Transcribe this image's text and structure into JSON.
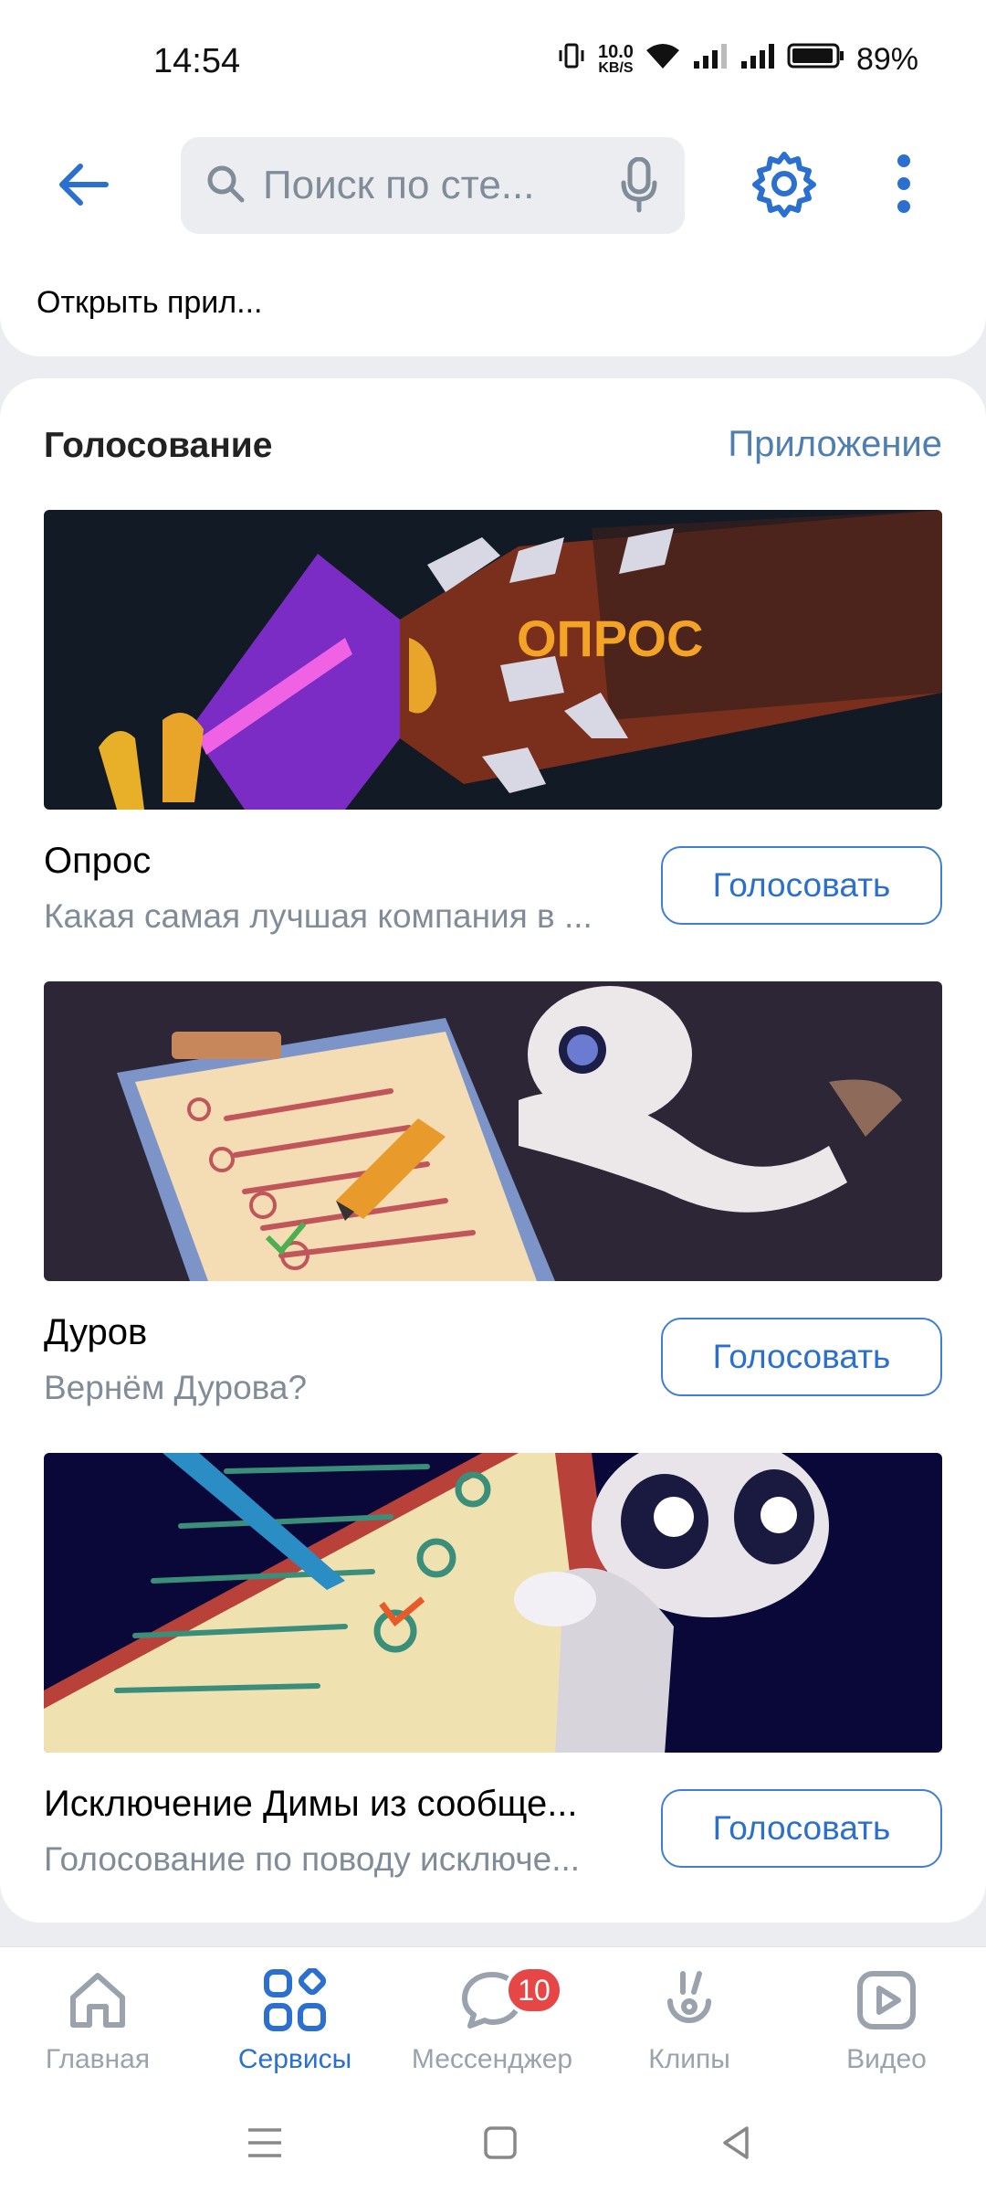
{
  "status_bar": {
    "time": "14:54",
    "speed_value": "10.0",
    "speed_unit": "KB/S",
    "battery": "89%"
  },
  "header": {
    "search_placeholder": "Поиск по сте...",
    "open_app_label": "Открыть прил..."
  },
  "poll_section": {
    "title": "Голосование",
    "link": "Приложение",
    "polls": [
      {
        "image_text": "ОПРОС",
        "name": "Опрос",
        "description": "Какая самая лучшая компания в ...",
        "button": "Голосовать"
      },
      {
        "name": "Дуров",
        "description": "Вернём Дурова?",
        "button": "Голосовать"
      },
      {
        "name": "Исключение Димы из сообще...",
        "description": "Голосование по поводу исключе...",
        "button": "Голосовать"
      }
    ]
  },
  "bottom_nav": {
    "items": [
      {
        "label": "Главная",
        "icon": "home-icon"
      },
      {
        "label": "Сервисы",
        "icon": "services-icon",
        "active": true
      },
      {
        "label": "Мессенджер",
        "icon": "messenger-icon",
        "badge": "10"
      },
      {
        "label": "Клипы",
        "icon": "clips-icon"
      },
      {
        "label": "Видео",
        "icon": "video-icon"
      }
    ]
  },
  "colors": {
    "accent": "#2b6fcf",
    "secondary_text": "#818c99",
    "badge": "#e64646",
    "background": "#ebedf0"
  }
}
